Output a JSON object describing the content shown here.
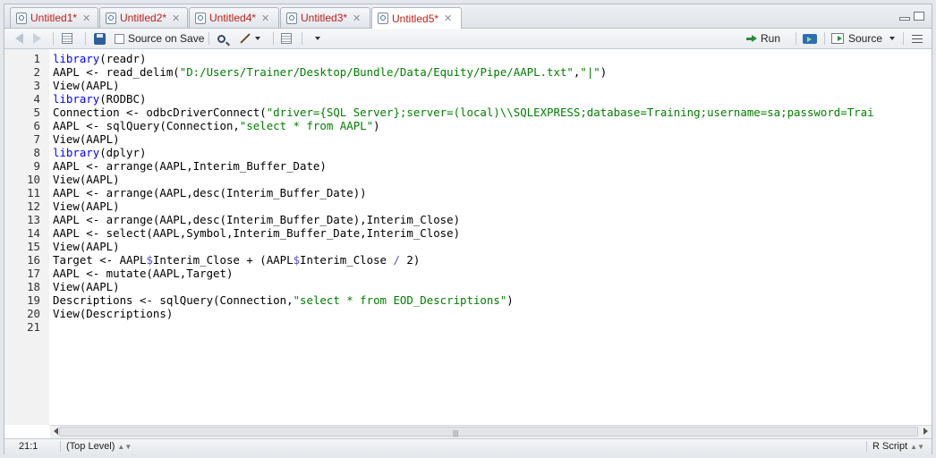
{
  "tabs": [
    {
      "label": "Untitled1*",
      "active": false
    },
    {
      "label": "Untitled2*",
      "active": false
    },
    {
      "label": "Untitled4*",
      "active": false
    },
    {
      "label": "Untitled3*",
      "active": false
    },
    {
      "label": "Untitled5*",
      "active": true
    }
  ],
  "toolbar": {
    "source_on_save": "Source on Save",
    "run": "Run",
    "source": "Source"
  },
  "editor": {
    "lines": [
      "library(readr)",
      "AAPL <- read_delim(\"D:/Users/Trainer/Desktop/Bundle/Data/Equity/Pipe/AAPL.txt\",\"|\")",
      "View(AAPL)",
      "library(RODBC)",
      "Connection <- odbcDriverConnect(\"driver={SQL Server};server=(local)\\\\SQLEXPRESS;database=Training;username=sa;password=Trai",
      "AAPL <- sqlQuery(Connection,\"select * from AAPL\")",
      "View(AAPL)",
      "library(dplyr)",
      "AAPL <- arrange(AAPL,Interim_Buffer_Date)",
      "View(AAPL)",
      "AAPL <- arrange(AAPL,desc(Interim_Buffer_Date))",
      "View(AAPL)",
      "AAPL <- arrange(AAPL,desc(Interim_Buffer_Date),Interim_Close)",
      "AAPL <- select(AAPL,Symbol,Interim_Buffer_Date,Interim_Close)",
      "View(AAPL)",
      "Target <- AAPL$Interim_Close + (AAPL$Interim_Close / 2)",
      "AAPL <- mutate(AAPL,Target)",
      "View(AAPL)",
      "Descriptions <- sqlQuery(Connection,\"select * from EOD_Descriptions\")",
      "View(Descriptions)",
      ""
    ]
  },
  "status": {
    "position": "21:1",
    "scope": "(Top Level)",
    "file_type": "R Script"
  },
  "colors": {
    "keyword": "#0000ff",
    "string": "#007f00",
    "operator": "#5a4fcf",
    "tab_modified": "#c0201a"
  }
}
